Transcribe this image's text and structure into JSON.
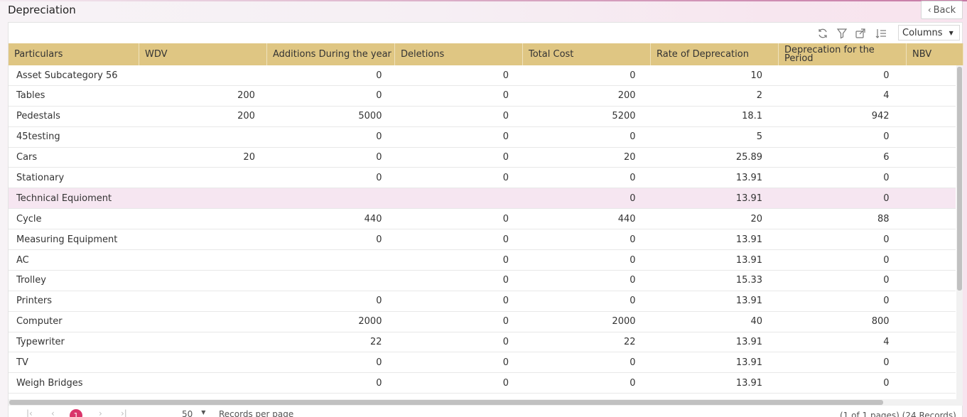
{
  "page": {
    "title": "Depreciation",
    "back_label": "Back"
  },
  "toolbar": {
    "icons": [
      "refresh-icon",
      "filter-icon",
      "export-icon",
      "sort-list-icon"
    ],
    "columns_label": "Columns"
  },
  "table": {
    "headers": [
      "Particulars",
      "WDV",
      "Additions During the year",
      "Deletions",
      "Total Cost",
      "Rate of Deprecation",
      "Deprecation for the Period",
      "NBV"
    ],
    "rows": [
      [
        "Asset Subcategory 56",
        "",
        "0",
        "0",
        "0",
        "10",
        "0",
        ""
      ],
      [
        "Tables",
        "200",
        "0",
        "0",
        "200",
        "2",
        "4",
        ""
      ],
      [
        "Pedestals",
        "200",
        "5000",
        "0",
        "5200",
        "18.1",
        "942",
        ""
      ],
      [
        "45testing",
        "",
        "0",
        "0",
        "0",
        "5",
        "0",
        ""
      ],
      [
        "Cars",
        "20",
        "0",
        "0",
        "20",
        "25.89",
        "6",
        ""
      ],
      [
        "Stationary",
        "",
        "0",
        "0",
        "0",
        "13.91",
        "0",
        ""
      ],
      [
        "Technical Equioment",
        "",
        "",
        "",
        "0",
        "13.91",
        "0",
        ""
      ],
      [
        "Cycle",
        "",
        "440",
        "0",
        "440",
        "20",
        "88",
        ""
      ],
      [
        "Measuring Equipment",
        "",
        "0",
        "0",
        "0",
        "13.91",
        "0",
        ""
      ],
      [
        "AC",
        "",
        "",
        "0",
        "0",
        "13.91",
        "0",
        ""
      ],
      [
        "Trolley",
        "",
        "",
        "0",
        "0",
        "15.33",
        "0",
        ""
      ],
      [
        "Printers",
        "",
        "0",
        "0",
        "0",
        "13.91",
        "0",
        ""
      ],
      [
        "Computer",
        "",
        "2000",
        "0",
        "2000",
        "40",
        "800",
        ""
      ],
      [
        "Typewriter",
        "",
        "22",
        "0",
        "22",
        "13.91",
        "4",
        ""
      ],
      [
        "TV",
        "",
        "0",
        "0",
        "0",
        "13.91",
        "0",
        ""
      ],
      [
        "Weigh Bridges",
        "",
        "0",
        "0",
        "0",
        "13.91",
        "0",
        ""
      ]
    ],
    "highlighted_row": 6
  },
  "pager": {
    "first": "|‹",
    "prev": "‹",
    "current_page": "1",
    "next": "›",
    "last": "›|",
    "page_size": "50",
    "page_size_label": "Records per page",
    "info": "(1 of 1 pages) (24 Records)"
  },
  "colors": {
    "header_bg": "#dfc683",
    "highlight_row": "#f6e6f1",
    "page_badge": "#d9346a"
  }
}
